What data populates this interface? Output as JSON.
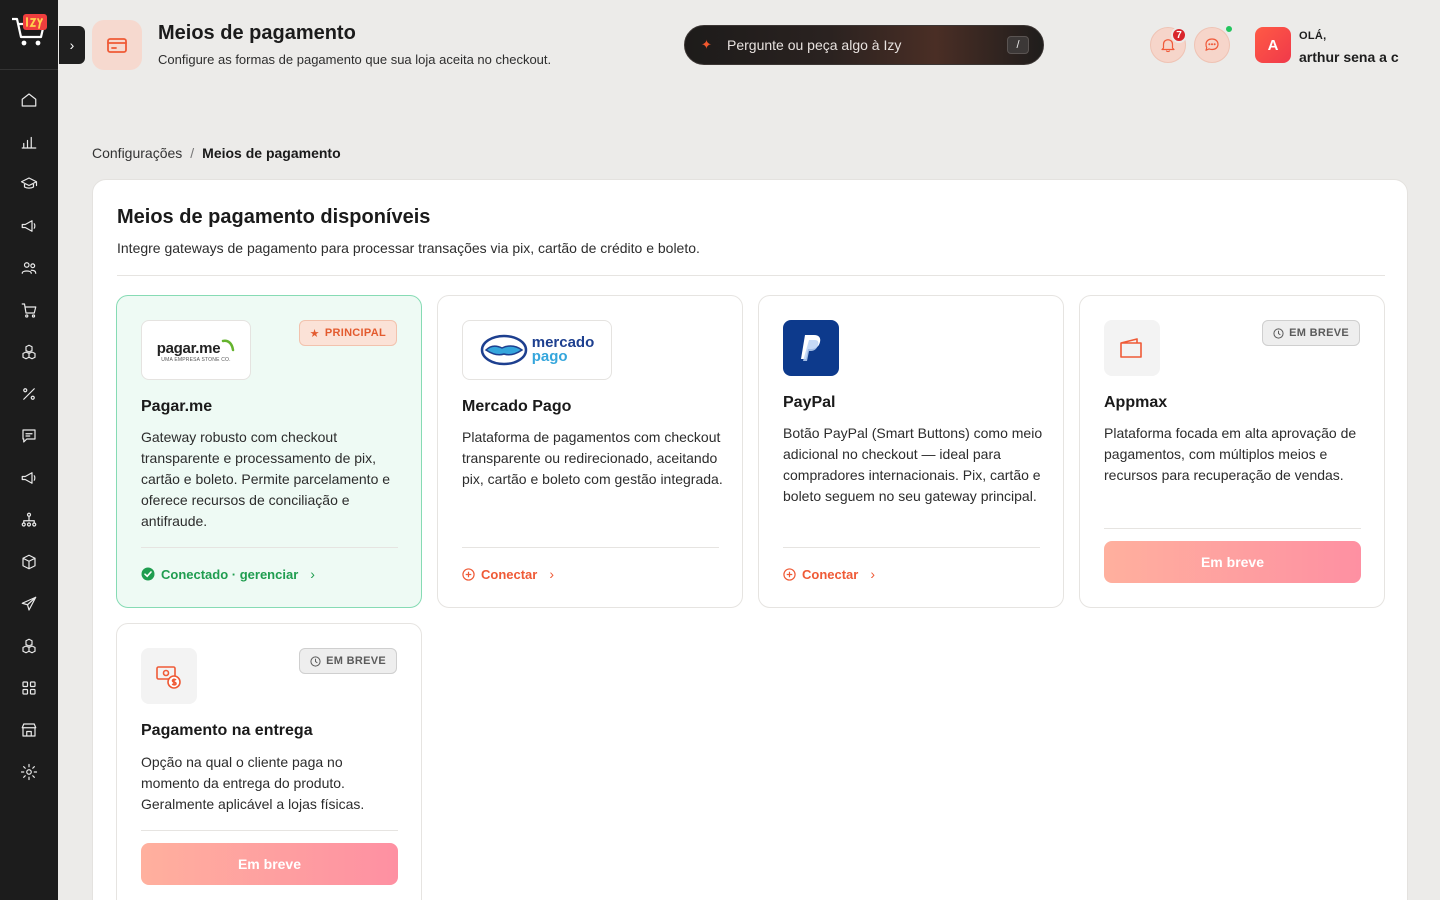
{
  "header": {
    "title": "Meios de pagamento",
    "subtitle": "Configure as formas de pagamento que sua loja aceita no checkout."
  },
  "ai": {
    "placeholder": "Pergunte ou peça algo à Izy",
    "shortcut": "/"
  },
  "notifications": {
    "count": "7"
  },
  "user": {
    "greeting": "OLÁ,",
    "name": "arthur sena a c",
    "initial": "A"
  },
  "breadcrumb": {
    "parent": "Configurações",
    "separator": "/",
    "current": "Meios de pagamento"
  },
  "panel": {
    "title": "Meios de pagamento disponíveis",
    "subtitle": "Integre gateways de pagamento para processar transações via pix, cartão de crédito e boleto."
  },
  "cards": [
    {
      "name": "Pagar.me",
      "logo_text": "pagar.me",
      "logo_sub": "UMA EMPRESA STONE CO.",
      "badge": "PRINCIPAL",
      "description": "Gateway robusto com checkout transparente e processamento de pix, cartão e boleto. Permite parcelamento e oferece recursos de conciliação e antifraude.",
      "action": "Conectado · gerenciar"
    },
    {
      "name": "Mercado Pago",
      "logo_text_1": "mercado",
      "logo_text_2": "pago",
      "description": "Plataforma de pagamentos com checkout transparente ou redirecionado, aceitando pix, cartão e boleto com gestão integrada.",
      "action": "Conectar"
    },
    {
      "name": "PayPal",
      "description": "Botão PayPal (Smart Buttons) como meio adicional no checkout — ideal para compradores internacionais. Pix, cartão e boleto seguem no seu gateway principal.",
      "action": "Conectar"
    },
    {
      "name": "Appmax",
      "badge": "EM BREVE",
      "description": "Plataforma focada em alta aprovação de pagamentos, com múltiplos meios e recursos para recuperação de vendas.",
      "button": "Em breve"
    },
    {
      "name": "Pagamento na entrega",
      "badge": "EM BREVE",
      "description": "Opção na qual o cliente paga no momento da entrega do produto. Geralmente aplicável a lojas físicas.",
      "button": "Em breve"
    }
  ],
  "colors": {
    "accent": "#ef5a36",
    "success": "#1f9d4f",
    "sidebar": "#1c1c1c"
  }
}
